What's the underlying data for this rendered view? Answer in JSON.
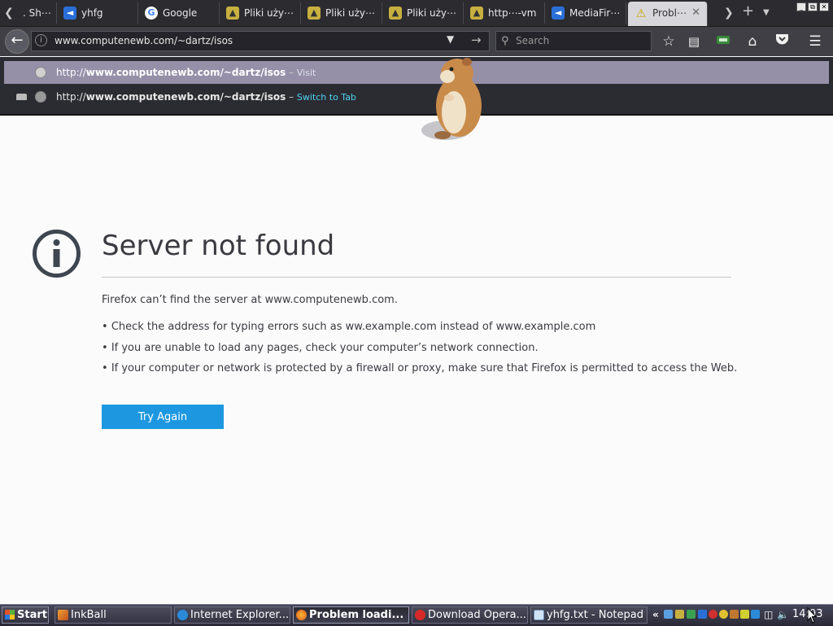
{
  "tabs": [
    {
      "title": ". Sh⋯",
      "favicon": "page-icon"
    },
    {
      "title": "yhfg",
      "favicon": "mediafire-icon"
    },
    {
      "title": "Google",
      "favicon": "google-icon"
    },
    {
      "title": "Pliki uży⋯",
      "favicon": "pliki-icon"
    },
    {
      "title": "Pliki uży⋯",
      "favicon": "pliki-icon"
    },
    {
      "title": "Pliki uży⋯",
      "favicon": "pliki-icon"
    },
    {
      "title": "http⋯-vm",
      "favicon": "pliki-icon"
    },
    {
      "title": "MediaFir⋯",
      "favicon": "mediafire-icon"
    },
    {
      "title": "Probl⋯",
      "favicon": "warning-icon",
      "active": true
    }
  ],
  "navbar": {
    "url": "www.computenewb.com/~dartz/isos",
    "search_placeholder": "Search"
  },
  "url_dropdown": {
    "rows": [
      {
        "prefix": "http://",
        "host_path": "www.computenewb.com/~dartz/isos",
        "sep": " – ",
        "action": "Visit"
      },
      {
        "prefix": "http://",
        "host_path": "www.computenewb.com/~dartz/isos",
        "sep": " – ",
        "action": "Switch to Tab"
      }
    ]
  },
  "error": {
    "title": "Server not found",
    "description": "Firefox can’t find the server at www.computenewb.com.",
    "bullets": [
      "Check the address for typing errors such as ww.example.com instead of www.example.com",
      "If you are unable to load any pages, check your computer’s network connection.",
      "If your computer or network is protected by a firewall or proxy, make sure that Firefox is permitted to access the Web."
    ],
    "button": "Try Again"
  },
  "taskbar": {
    "start_label": "Start",
    "items": [
      {
        "label": "InkBall",
        "icon": "inkball-icon"
      },
      {
        "label": "Internet Explorer...",
        "icon": "ie-icon"
      },
      {
        "label": "Problem loadi...",
        "icon": "firefox-icon",
        "active": true
      },
      {
        "label": "Download Opera...",
        "icon": "opera-icon"
      },
      {
        "label": "yhfg.txt - Notepad",
        "icon": "notepad-icon"
      }
    ],
    "tray_expand": "«",
    "clock": "14:03"
  },
  "colors": {
    "accent_button": "#1d98e0",
    "dropdown_highlight": "#9590a8",
    "switch_to_tab": "#4fd4f0"
  }
}
